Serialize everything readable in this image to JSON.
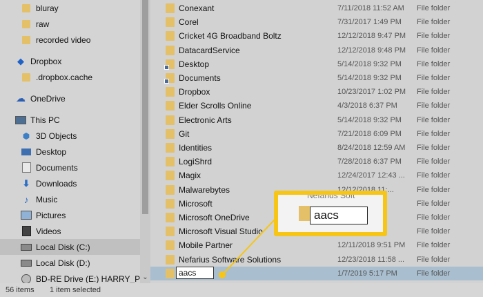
{
  "nav": {
    "items": [
      {
        "label": "bluray",
        "icon": "folder-icon",
        "indent": 2,
        "selected": false
      },
      {
        "label": "raw",
        "icon": "folder-icon",
        "indent": 2,
        "selected": false
      },
      {
        "label": "recorded video",
        "icon": "folder-icon",
        "indent": 2,
        "selected": false
      },
      {
        "label": "Dropbox",
        "icon": "dropbox-icon",
        "indent": 1,
        "selected": false
      },
      {
        "label": ".dropbox.cache",
        "icon": "folder-icon",
        "indent": 2,
        "selected": false
      },
      {
        "label": "OneDrive",
        "icon": "onedrive-icon",
        "indent": 1,
        "selected": false
      },
      {
        "label": "This PC",
        "icon": "pc-icon",
        "indent": 1,
        "selected": false
      },
      {
        "label": "3D Objects",
        "icon": "3d-objects-icon",
        "indent": 2,
        "selected": false
      },
      {
        "label": "Desktop",
        "icon": "desktop-icon",
        "indent": 2,
        "selected": false
      },
      {
        "label": "Documents",
        "icon": "documents-icon",
        "indent": 2,
        "selected": false
      },
      {
        "label": "Downloads",
        "icon": "downloads-icon",
        "indent": 2,
        "selected": false
      },
      {
        "label": "Music",
        "icon": "music-icon",
        "indent": 2,
        "selected": false
      },
      {
        "label": "Pictures",
        "icon": "pictures-icon",
        "indent": 2,
        "selected": false
      },
      {
        "label": "Videos",
        "icon": "videos-icon",
        "indent": 2,
        "selected": false
      },
      {
        "label": "Local Disk (C:)",
        "icon": "drive-icon",
        "indent": 2,
        "selected": true
      },
      {
        "label": "Local Disk (D:)",
        "icon": "drive-icon",
        "indent": 2,
        "selected": false
      },
      {
        "label": "BD-RE Drive (E:) HARRY_POTT",
        "icon": "disc-icon",
        "indent": 2,
        "selected": false
      }
    ]
  },
  "files": [
    {
      "name": "Conexant",
      "date": "7/11/2018 11:52 AM",
      "type": "File folder"
    },
    {
      "name": "Corel",
      "date": "7/31/2017 1:49 PM",
      "type": "File folder"
    },
    {
      "name": "Cricket 4G Broadband Boltz",
      "date": "12/12/2018 9:47 PM",
      "type": "File folder"
    },
    {
      "name": "DatacardService",
      "date": "12/12/2018 9:48 PM",
      "type": "File folder"
    },
    {
      "name": "Desktop",
      "date": "5/14/2018 9:32 PM",
      "type": "File folder",
      "special": true
    },
    {
      "name": "Documents",
      "date": "5/14/2018 9:32 PM",
      "type": "File folder",
      "special": true
    },
    {
      "name": "Dropbox",
      "date": "10/23/2017 1:02 PM",
      "type": "File folder"
    },
    {
      "name": "Elder Scrolls Online",
      "date": "4/3/2018 6:37 PM",
      "type": "File folder"
    },
    {
      "name": "Electronic Arts",
      "date": "5/14/2018 9:32 PM",
      "type": "File folder"
    },
    {
      "name": "Git",
      "date": "7/21/2018 6:09 PM",
      "type": "File folder"
    },
    {
      "name": "Identities",
      "date": "8/24/2018 12:59 AM",
      "type": "File folder"
    },
    {
      "name": "LogiShrd",
      "date": "7/28/2018 6:37 PM",
      "type": "File folder"
    },
    {
      "name": "Magix",
      "date": "12/24/2017 12:43 ...",
      "type": "File folder"
    },
    {
      "name": "Malwarebytes",
      "date": "12/12/2018 11:...",
      "type": "File folder"
    },
    {
      "name": "Microsoft",
      "date": "",
      "type": "File folder"
    },
    {
      "name": "Microsoft OneDrive",
      "date": "",
      "type": "File folder"
    },
    {
      "name": "Microsoft Visual Studio",
      "date": "",
      "type": "File folder"
    },
    {
      "name": "Mobile Partner",
      "date": "12/11/2018 9:51 PM",
      "type": "File folder"
    },
    {
      "name": "Nefarius Software Solutions",
      "date": "12/23/2018 11:58 ...",
      "type": "File folder"
    },
    {
      "name": "aacs",
      "date": "1/7/2019 5:17 PM",
      "type": "File folder",
      "selected": true,
      "renaming": true
    }
  ],
  "status": {
    "count": "56 items",
    "selection": "1 item selected"
  },
  "callout": {
    "ghost_text": "Nefarius Soft",
    "input_value": "aacs"
  },
  "colors": {
    "callout_accent": "#f7c515",
    "selection_row": "#a9bfd0"
  }
}
